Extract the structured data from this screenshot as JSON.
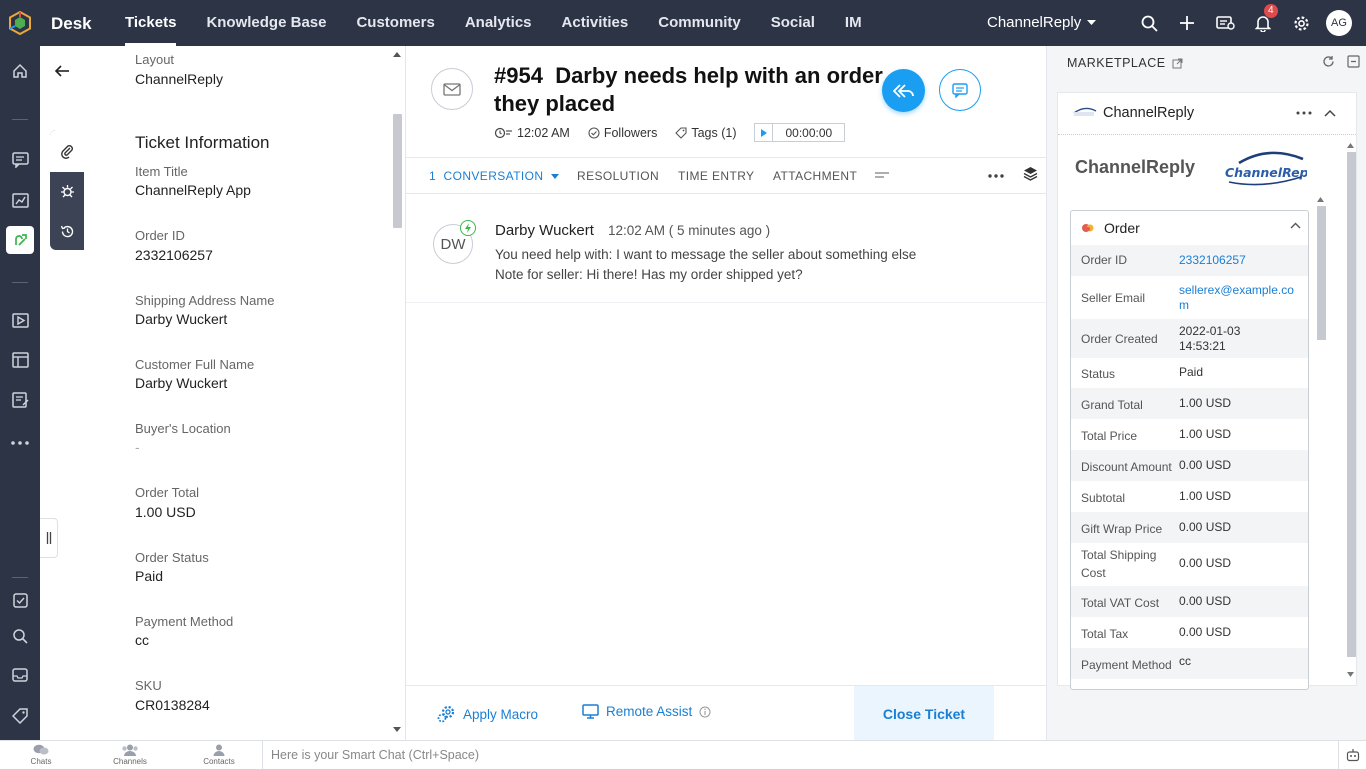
{
  "topbar": {
    "app_name": "Desk",
    "nav": [
      "Tickets",
      "Knowledge Base",
      "Customers",
      "Analytics",
      "Activities",
      "Community",
      "Social",
      "IM"
    ],
    "department": "ChannelReply",
    "notification_count": "4",
    "avatar_initials": "AG"
  },
  "ticket_props": {
    "fields": [
      {
        "label": "Layout",
        "value": "ChannelReply"
      },
      {
        "label": "Item Title",
        "value": "ChannelReply App"
      },
      {
        "label": "Order ID",
        "value": "2332106257"
      },
      {
        "label": "Shipping Address Name",
        "value": "Darby Wuckert"
      },
      {
        "label": "Customer Full Name",
        "value": "Darby Wuckert"
      },
      {
        "label": "Buyer's Location",
        "value": "-"
      },
      {
        "label": "Order Total",
        "value": "1.00 USD"
      },
      {
        "label": "Order Status",
        "value": "Paid"
      },
      {
        "label": "Payment Method",
        "value": "cc"
      },
      {
        "label": "SKU",
        "value": "CR0138284"
      }
    ],
    "section_title": "Ticket Information"
  },
  "ticket": {
    "number": "#954",
    "subject": "Darby needs help with an order they placed",
    "time": "12:02 AM",
    "followers_label": "Followers",
    "tags_label": "Tags (1)",
    "timer": "00:00:00"
  },
  "tabs": {
    "conversation": "1  CONVERSATION",
    "resolution": "RESOLUTION",
    "time_entry": "TIME ENTRY",
    "attachment": "ATTACHMENT"
  },
  "message": {
    "avatar": "DW",
    "author": "Darby Wuckert",
    "time": "12:02 AM ( 5 minutes ago )",
    "line1": "You need help with: I want to message the seller about something else",
    "line2": "Note for seller: Hi there! Has my order shipped yet?"
  },
  "actions": {
    "apply_macro": "Apply Macro",
    "remote_assist": "Remote Assist",
    "close_ticket": "Close Ticket"
  },
  "marketplace": {
    "title": "MARKETPLACE",
    "widget_name": "ChannelReply",
    "brand_title": "ChannelReply",
    "brand_logo_text": "ChannelReply",
    "order_title": "Order",
    "rows": [
      {
        "key": "Order ID",
        "value": "2332106257",
        "link": true
      },
      {
        "key": "Seller Email",
        "value": "sellerex@example.com",
        "link": true
      },
      {
        "key": "Order Created",
        "value": "2022-01-03 14:53:21"
      },
      {
        "key": "Status",
        "value": "Paid"
      },
      {
        "key": "Grand Total",
        "value": "1.00 USD"
      },
      {
        "key": "Total Price",
        "value": "1.00 USD"
      },
      {
        "key": "Discount Amount",
        "value": "0.00 USD"
      },
      {
        "key": "Subtotal",
        "value": "1.00 USD"
      },
      {
        "key": "Gift Wrap Price",
        "value": "0.00 USD"
      },
      {
        "key": "Total Shipping Cost",
        "value": "0.00 USD"
      },
      {
        "key": "Total VAT Cost",
        "value": "0.00 USD"
      },
      {
        "key": "Total Tax",
        "value": "0.00 USD"
      },
      {
        "key": "Payment Method",
        "value": "cc"
      }
    ]
  },
  "bottombar": {
    "chats": "Chats",
    "channels": "Channels",
    "contacts": "Contacts",
    "smart_chat_placeholder": "Here is your Smart Chat (Ctrl+Space)"
  },
  "colors": {
    "topbar": "#2d3446",
    "accent": "#1a9ef2",
    "link": "#1a7fd4"
  }
}
